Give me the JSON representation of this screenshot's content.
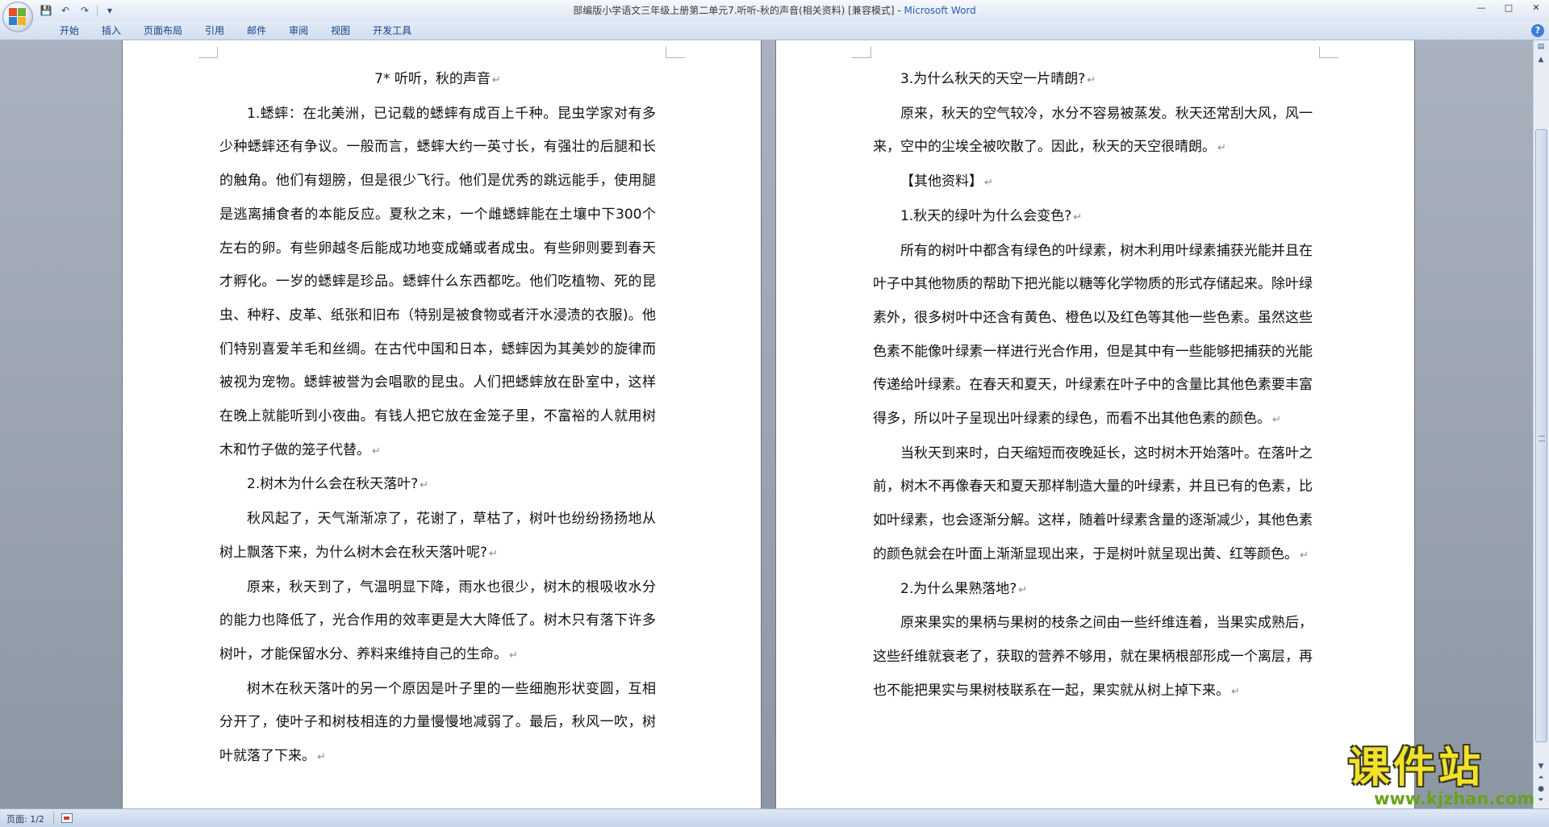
{
  "window": {
    "title": "部编版小学语文三年级上册第二单元7.听听-秋的声音(相关资料) [兼容模式] - ",
    "app_name": "Microsoft Word",
    "controls": {
      "minimize": "—",
      "maximize": "□",
      "close": "✕"
    }
  },
  "qat": {
    "save_icon": "💾",
    "undo_icon": "↶",
    "redo_icon": "↷",
    "customize_icon": "▾"
  },
  "ribbon": {
    "tabs": [
      "开始",
      "插入",
      "页面布局",
      "引用",
      "邮件",
      "审阅",
      "视图",
      "开发工具"
    ],
    "help": "?"
  },
  "document": {
    "left_page": {
      "heading": "7* 听听，秋的声音",
      "paragraphs": [
        "1.蟋蟀：在北美洲，已记载的蟋蟀有成百上千种。昆虫学家对有多少种蟋蟀还有争议。一般而言，蟋蟀大约一英寸长，有强壮的后腿和长的触角。他们有翅膀，但是很少飞行。他们是优秀的跳远能手，使用腿是逃离捕食者的本能反应。夏秋之末，一个雌蟋蟀能在土壤中下300个左右的卵。有些卵越冬后能成功地变成蛹或者成虫。有些卵则要到春天才孵化。一岁的蟋蟀是珍品。蟋蟀什么东西都吃。他们吃植物、死的昆虫、种籽、皮革、纸张和旧布（特别是被食物或者汗水浸渍的衣服)。他们特别喜爱羊毛和丝绸。在古代中国和日本，蟋蟀因为其美妙的旋律而被视为宠物。蟋蟀被誉为会唱歌的昆虫。人们把蟋蟀放在卧室中，这样在晚上就能听到小夜曲。有钱人把它放在金笼子里，不富裕的人就用树木和竹子做的笼子代替。",
        "2.树木为什么会在秋天落叶?",
        "秋风起了，天气渐渐凉了，花谢了，草枯了，树叶也纷纷扬扬地从树上飘落下来，为什么树木会在秋天落叶呢?",
        "原来，秋天到了，气温明显下降，雨水也很少，树木的根吸收水分的能力也降低了，光合作用的效率更是大大降低了。树木只有落下许多树叶，才能保留水分、养料来维持自己的生命。",
        "树木在秋天落叶的另一个原因是叶子里的一些细胞形状变圆，互相分开了，使叶子和树枝相连的力量慢慢地减弱了。最后，秋风一吹，树叶就落了下来。"
      ]
    },
    "right_page": {
      "paragraphs": [
        "3.为什么秋天的天空一片晴朗?",
        "原来，秋天的空气较冷，水分不容易被蒸发。秋天还常刮大风，风一来，空中的尘埃全被吹散了。因此，秋天的天空很晴朗。",
        "【其他资料】",
        "1.秋天的绿叶为什么会变色?",
        "所有的树叶中都含有绿色的叶绿素，树木利用叶绿素捕获光能并且在叶子中其他物质的帮助下把光能以糖等化学物质的形式存储起来。除叶绿素外，很多树叶中还含有黄色、橙色以及红色等其他一些色素。虽然这些色素不能像叶绿素一样进行光合作用，但是其中有一些能够把捕获的光能传递给叶绿素。在春天和夏天，叶绿素在叶子中的含量比其他色素要丰富得多，所以叶子呈现出叶绿素的绿色，而看不出其他色素的颜色。",
        "当秋天到来时，白天缩短而夜晚延长，这时树木开始落叶。在落叶之前，树木不再像春天和夏天那样制造大量的叶绿素，并且已有的色素，比如叶绿素，也会逐渐分解。这样，随着叶绿素含量的逐渐减少，其他色素的颜色就会在叶面上渐渐显现出来，于是树叶就呈现出黄、红等颜色。",
        "2.为什么果熟落地?",
        "原来果实的果柄与果树的枝条之间由一些纤维连着，当果实成熟后，这些纤维就衰老了，获取的营养不够用，就在果柄根部形成一个离层，再也不能把果实与果树枝联系在一起，果实就从树上掉下来。"
      ]
    },
    "paragraph_mark": "↵"
  },
  "statusbar": {
    "page": "页面: 1/2"
  },
  "watermark": {
    "title": "课件站",
    "url": "www.kjzhan.com"
  },
  "colors": {
    "app_name": "#2a5db0",
    "ribbon_tab_text": "#15428b",
    "workspace": "#9ea6b3",
    "watermark_yellow": "#f2e229",
    "watermark_green": "#6aa11e"
  }
}
